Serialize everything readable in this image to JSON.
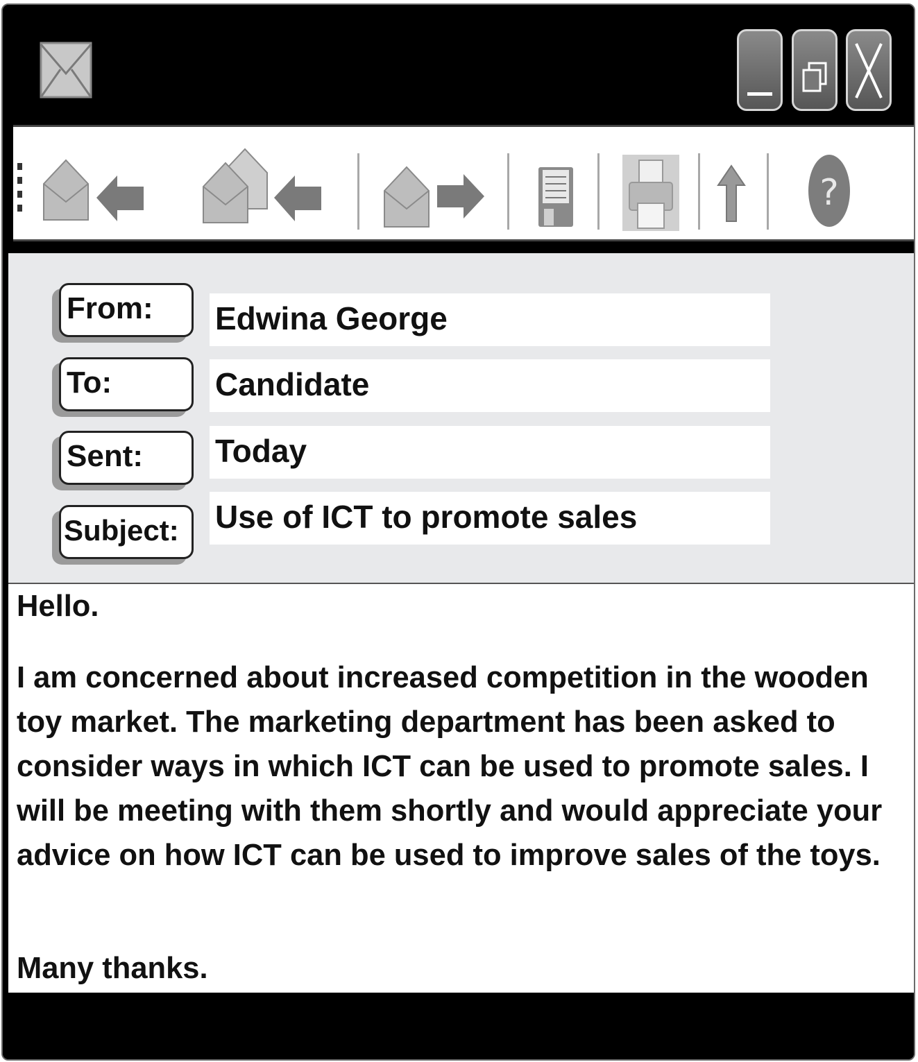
{
  "window": {
    "title_icon": "envelope-icon",
    "controls": [
      "minimize-icon",
      "restore-icon",
      "close-icon"
    ]
  },
  "toolbar": {
    "buttons": [
      "reply-icon",
      "reply-all-icon",
      "forward-icon",
      "save-icon",
      "print-icon",
      "upload-icon",
      "help-icon"
    ],
    "help_glyph": "?"
  },
  "header": {
    "from_label": "From:",
    "from_value": "Edwina George",
    "to_label": "To:",
    "to_value": "Candidate",
    "sent_label": "Sent:",
    "sent_value": "Today",
    "subject_label": "Subject:",
    "subject_value": "Use of ICT to promote sales"
  },
  "message": {
    "greeting": "Hello.",
    "paragraph": "I am concerned about increased competition in the wooden toy market. The marketing department has been asked to consider ways in which ICT can be used to promote sales. I will be meeting with them shortly and would appreciate your advice on how ICT can be used to improve sales of the toys.",
    "closing": "Many thanks."
  }
}
